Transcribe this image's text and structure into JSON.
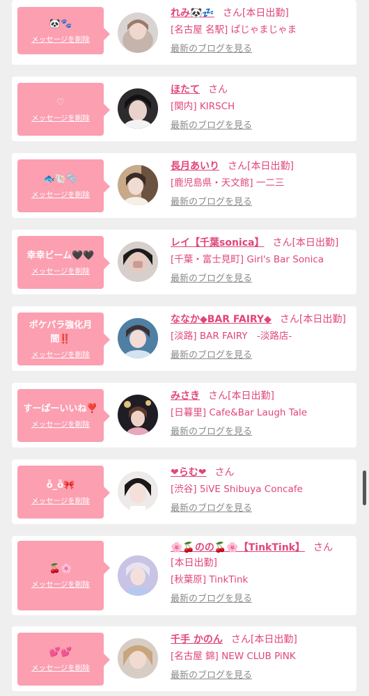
{
  "colors": {
    "accent": "#fb9fb1",
    "name": "#e0457b",
    "muted": "#8a8a8a",
    "bg": "#efefef"
  },
  "delete_label": "メッセージを削除",
  "blog_label": "最新のブログを見る",
  "san_label": "さん",
  "cards": [
    {
      "message": "🐼🐾",
      "name": "れみ🐼💤",
      "status": "[本日出勤]",
      "shop": "[名古屋 名駅] ぱじゃまじゃま"
    },
    {
      "message": "♡",
      "name": "ほたて",
      "status": "",
      "shop": "[関内] KIRSCH"
    },
    {
      "message": "🐟🐚🫧",
      "name": "長月あいり",
      "status": "[本日出勤]",
      "shop": "[鹿児島県・天文館] 一二三"
    },
    {
      "message": "幸幸ビーム🖤🖤",
      "name": "レイ【千葉sonica】",
      "status": "[本日出勤]",
      "shop": "[千葉・富士見町] Girl's Bar Sonica"
    },
    {
      "message": "ポケパラ強化月間‼️",
      "name": "ななか◆BAR FAIRY◆",
      "status": "[本日出勤]",
      "shop": "[淡路] BAR FAIRY　-淡路店-"
    },
    {
      "message": "すーぱーいいね❣️",
      "name": "みさき",
      "status": "[本日出勤]",
      "shop": "[日暮里] Cafe&Bar Laugh Tale"
    },
    {
      "message": "ỗ_ỗ🎀",
      "name": "❤らむ❤",
      "status": "",
      "shop": "[渋谷] 5iVE Shibuya Concafe"
    },
    {
      "message": "🍒🌸",
      "name": "🌸🍒のの🍒🌸【TinkTink】",
      "status": "[本日出勤]",
      "shop": "[秋葉原] TinkTink"
    },
    {
      "message": "💕💕",
      "name": "千手 かのん",
      "status": "[本日出勤]",
      "shop": "[名古屋 錦] NEW CLUB PiNK"
    }
  ]
}
